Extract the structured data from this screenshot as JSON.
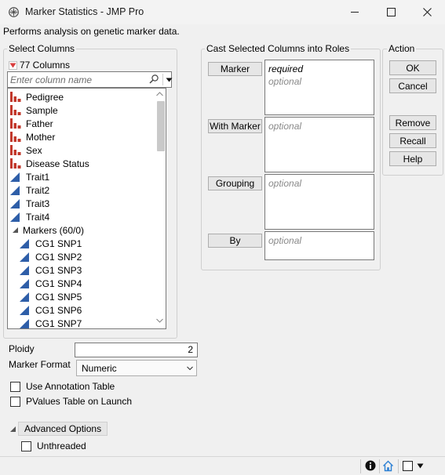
{
  "window": {
    "title": "Marker Statistics - JMP Pro",
    "description": "Performs analysis on genetic marker data."
  },
  "select_columns": {
    "heading": "Select Columns",
    "count_label": "77 Columns",
    "search_placeholder": "Enter column name",
    "items": [
      {
        "label": "Pedigree",
        "icon": "nominal-bar-icon"
      },
      {
        "label": "Sample",
        "icon": "nominal-bar-icon"
      },
      {
        "label": "Father",
        "icon": "nominal-bar-icon"
      },
      {
        "label": "Mother",
        "icon": "nominal-bar-icon"
      },
      {
        "label": "Sex",
        "icon": "nominal-bar-icon"
      },
      {
        "label": "Disease Status",
        "icon": "nominal-bar-icon"
      },
      {
        "label": "Trait1",
        "icon": "continuous-triangle-icon"
      },
      {
        "label": "Trait2",
        "icon": "continuous-triangle-icon"
      },
      {
        "label": "Trait3",
        "icon": "continuous-triangle-icon"
      },
      {
        "label": "Trait4",
        "icon": "continuous-triangle-icon"
      },
      {
        "label": "Markers (60/0)",
        "icon": "group-disclosure-icon"
      },
      {
        "label": "CG1 SNP1",
        "icon": "continuous-triangle-icon"
      },
      {
        "label": "CG1 SNP2",
        "icon": "continuous-triangle-icon"
      },
      {
        "label": "CG1 SNP3",
        "icon": "continuous-triangle-icon"
      },
      {
        "label": "CG1 SNP4",
        "icon": "continuous-triangle-icon"
      },
      {
        "label": "CG1 SNP5",
        "icon": "continuous-triangle-icon"
      },
      {
        "label": "CG1 SNP6",
        "icon": "continuous-triangle-icon"
      },
      {
        "label": "CG1 SNP7",
        "icon": "continuous-triangle-icon"
      }
    ]
  },
  "cast_roles": {
    "heading": "Cast Selected Columns into Roles",
    "roles": [
      {
        "button": "Marker",
        "lines": [
          "required",
          "optional"
        ]
      },
      {
        "button": "With Marker",
        "lines": [
          "optional"
        ]
      },
      {
        "button": "Grouping",
        "lines": [
          "optional"
        ]
      },
      {
        "button": "By",
        "lines": [
          "optional"
        ]
      }
    ]
  },
  "action": {
    "heading": "Action",
    "ok": "OK",
    "cancel": "Cancel",
    "remove": "Remove",
    "recall": "Recall",
    "help": "Help"
  },
  "options": {
    "ploidy_label": "Ploidy",
    "ploidy_value": "2",
    "marker_format_label": "Marker Format",
    "marker_format_value": "Numeric",
    "use_annotation_label": "Use Annotation Table",
    "pvalues_label": "PValues Table on Launch",
    "advanced_label": "Advanced Options",
    "unthreaded_label": "Unthreaded"
  },
  "colors": {
    "nominal_icon": "#c2382b",
    "continuous_icon": "#2e5ea8",
    "disclosure_triangle": "#d83c3c"
  }
}
